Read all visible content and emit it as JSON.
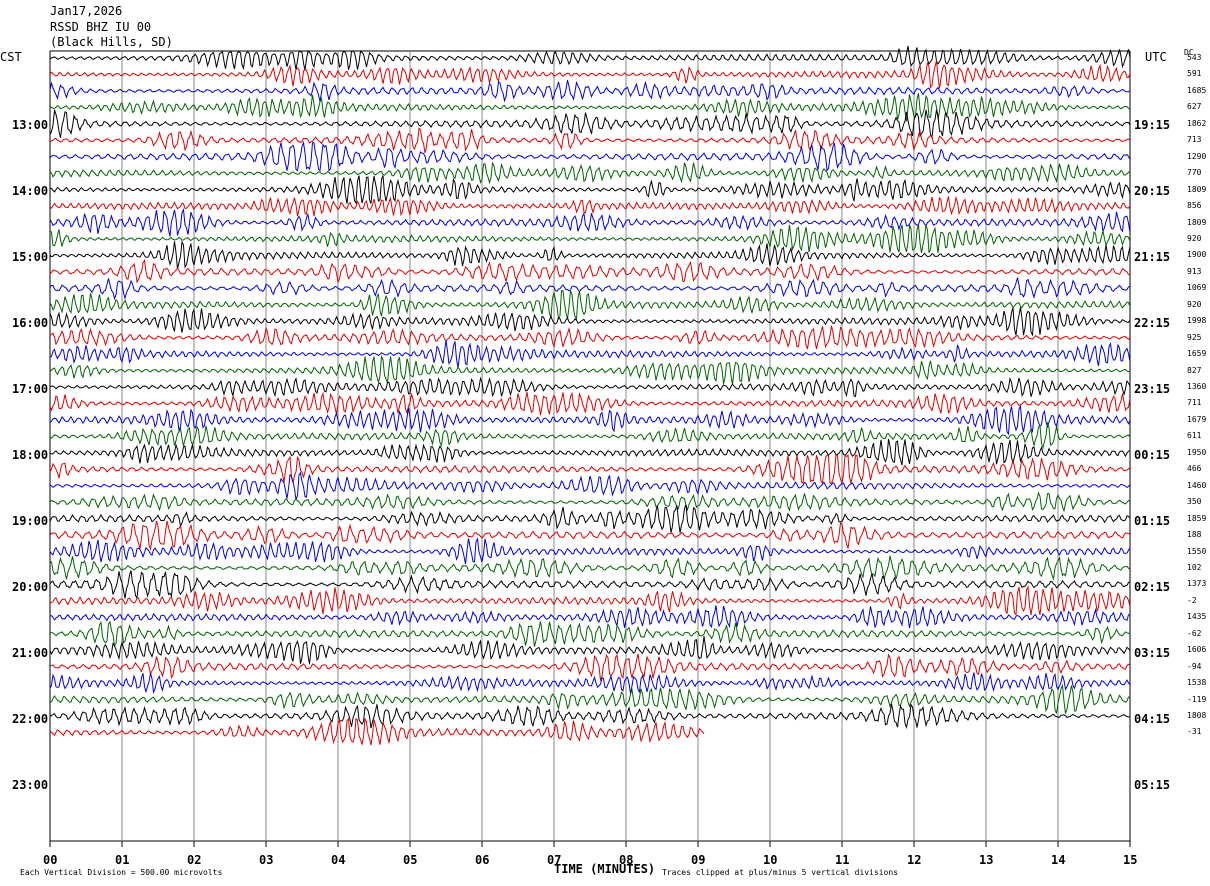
{
  "header": {
    "date": "Jan17,2026",
    "station": "RSSD BHZ IU 00",
    "location": "(Black Hills, SD)"
  },
  "left_zone": "CST",
  "right_zone": "UTC",
  "dc_label": "DC",
  "left_times": [
    "13:00",
    "14:00",
    "15:00",
    "16:00",
    "17:00",
    "18:00",
    "19:00",
    "20:00",
    "21:00",
    "22:00",
    "23:00"
  ],
  "right_times": [
    "19:15",
    "20:15",
    "21:15",
    "22:15",
    "23:15",
    "00:15",
    "01:15",
    "02:15",
    "03:15",
    "04:15",
    "05:15"
  ],
  "right_values": [
    "543",
    "591",
    "1685",
    "627",
    "1862",
    "713",
    "1290",
    "770",
    "1809",
    "856",
    "1809",
    "920",
    "1900",
    "913",
    "1069",
    "920",
    "1998",
    "925",
    "1659",
    "827",
    "1360",
    "711",
    "1679",
    "611",
    "1950",
    "466",
    "1460",
    "350",
    "1859",
    "188",
    "1550",
    "102",
    "1373",
    "-2",
    "1435",
    "-62",
    "1606",
    "-94",
    "1538",
    "-119",
    "1808",
    "-31"
  ],
  "footer": {
    "division": "Each Vertical Division =  500.00 microvolts",
    "x_title": "TIME (MINUTES)",
    "clip_note": "Traces clipped at plus/minus 5 vertical divisions"
  },
  "chart_data": {
    "type": "line",
    "title": "RSSD BHZ IU 00 (Black Hills, SD) Jan17,2026",
    "xlabel": "TIME (MINUTES)",
    "ylabel": "",
    "xlim": [
      0,
      15
    ],
    "x_ticks": [
      "00",
      "01",
      "02",
      "03",
      "04",
      "05",
      "06",
      "07",
      "08",
      "09",
      "10",
      "11",
      "12",
      "13",
      "14",
      "15"
    ],
    "trace_minutes": 15,
    "trace_colors": [
      "#000000",
      "#e00000",
      "#0000e0",
      "#006400"
    ],
    "trace_count": 42,
    "last_trace_end_minute": 9.1,
    "grid": true,
    "vertical_division_microvolts": 500,
    "clip_divisions": 5
  }
}
